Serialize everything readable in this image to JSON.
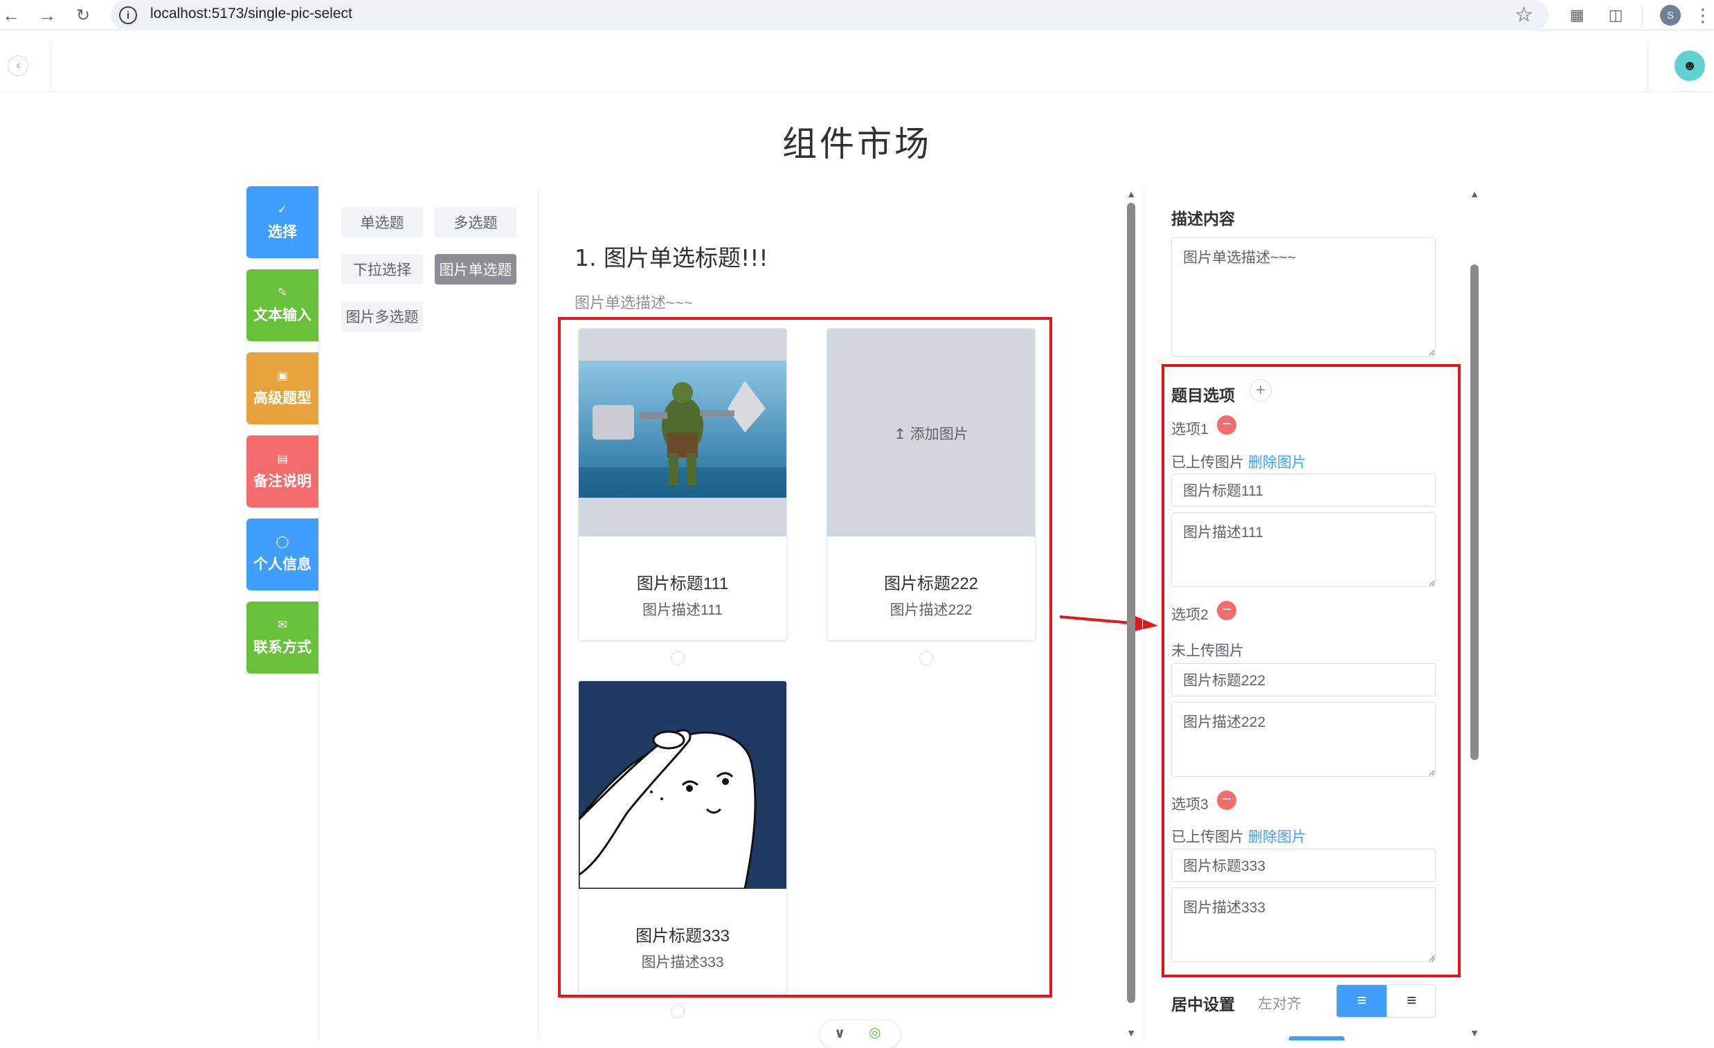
{
  "browser": {
    "url": "localhost:5173/single-pic-select",
    "profile_initial": "S",
    "icons": [
      "back-arrow-icon",
      "forward-arrow-icon",
      "reload-icon",
      "info-icon",
      "star-icon",
      "qr-code-icon",
      "extensions-icon"
    ]
  },
  "header": {
    "title": "组件市场"
  },
  "categories": [
    {
      "label": "选择",
      "icon": "check-circle-icon",
      "color": "#409eff"
    },
    {
      "label": "文本输入",
      "icon": "edit-icon",
      "color": "#67c23a"
    },
    {
      "label": "高级题型",
      "icon": "box-icon",
      "color": "#e6a23c"
    },
    {
      "label": "备注说明",
      "icon": "comment-icon",
      "color": "#f56c6c"
    },
    {
      "label": "个人信息",
      "icon": "user-icon",
      "color": "#409eff"
    },
    {
      "label": "联系方式",
      "icon": "mail-icon",
      "color": "#67c23a"
    }
  ],
  "types": [
    {
      "label": "单选题",
      "active": false
    },
    {
      "label": "多选题",
      "active": false
    },
    {
      "label": "下拉选择",
      "active": false
    },
    {
      "label": "图片单选题",
      "active": true
    },
    {
      "label": "图片多选题",
      "active": false
    }
  ],
  "preview": {
    "title": "1.  图片单选标题!!!",
    "desc": "图片单选描述~~~",
    "add_image_label": "添加图片",
    "options": [
      {
        "title": "图片标题111",
        "desc": "图片描述111",
        "image": "hulk-figure-image"
      },
      {
        "title": "图片标题222",
        "desc": "图片描述222",
        "image": ""
      },
      {
        "title": "图片标题333",
        "desc": "图片描述333",
        "image": "cartoon-seal-image"
      }
    ]
  },
  "settings": {
    "desc_label": "描述内容",
    "desc_value": "图片单选描述~~~",
    "options_label": "题目选项",
    "uploaded_label": "已上传图片",
    "not_uploaded_label": "未上传图片",
    "delete_image_label": "删除图片",
    "options": [
      {
        "label": "选项1",
        "upload_status": "已上传图片",
        "has_image": true,
        "title": "图片标题111",
        "desc": "图片描述111"
      },
      {
        "label": "选项2",
        "upload_status": "未上传图片",
        "has_image": false,
        "title": "图片标题222",
        "desc": "图片描述222"
      },
      {
        "label": "选项3",
        "upload_status": "已上传图片",
        "has_image": true,
        "title": "图片标题333",
        "desc": "图片描述333"
      }
    ],
    "center_label": "居中设置",
    "align_value": "左对齐"
  },
  "colors": {
    "accent": "#409eff",
    "danger": "#f56c6c",
    "annotation": "#e8141b"
  }
}
